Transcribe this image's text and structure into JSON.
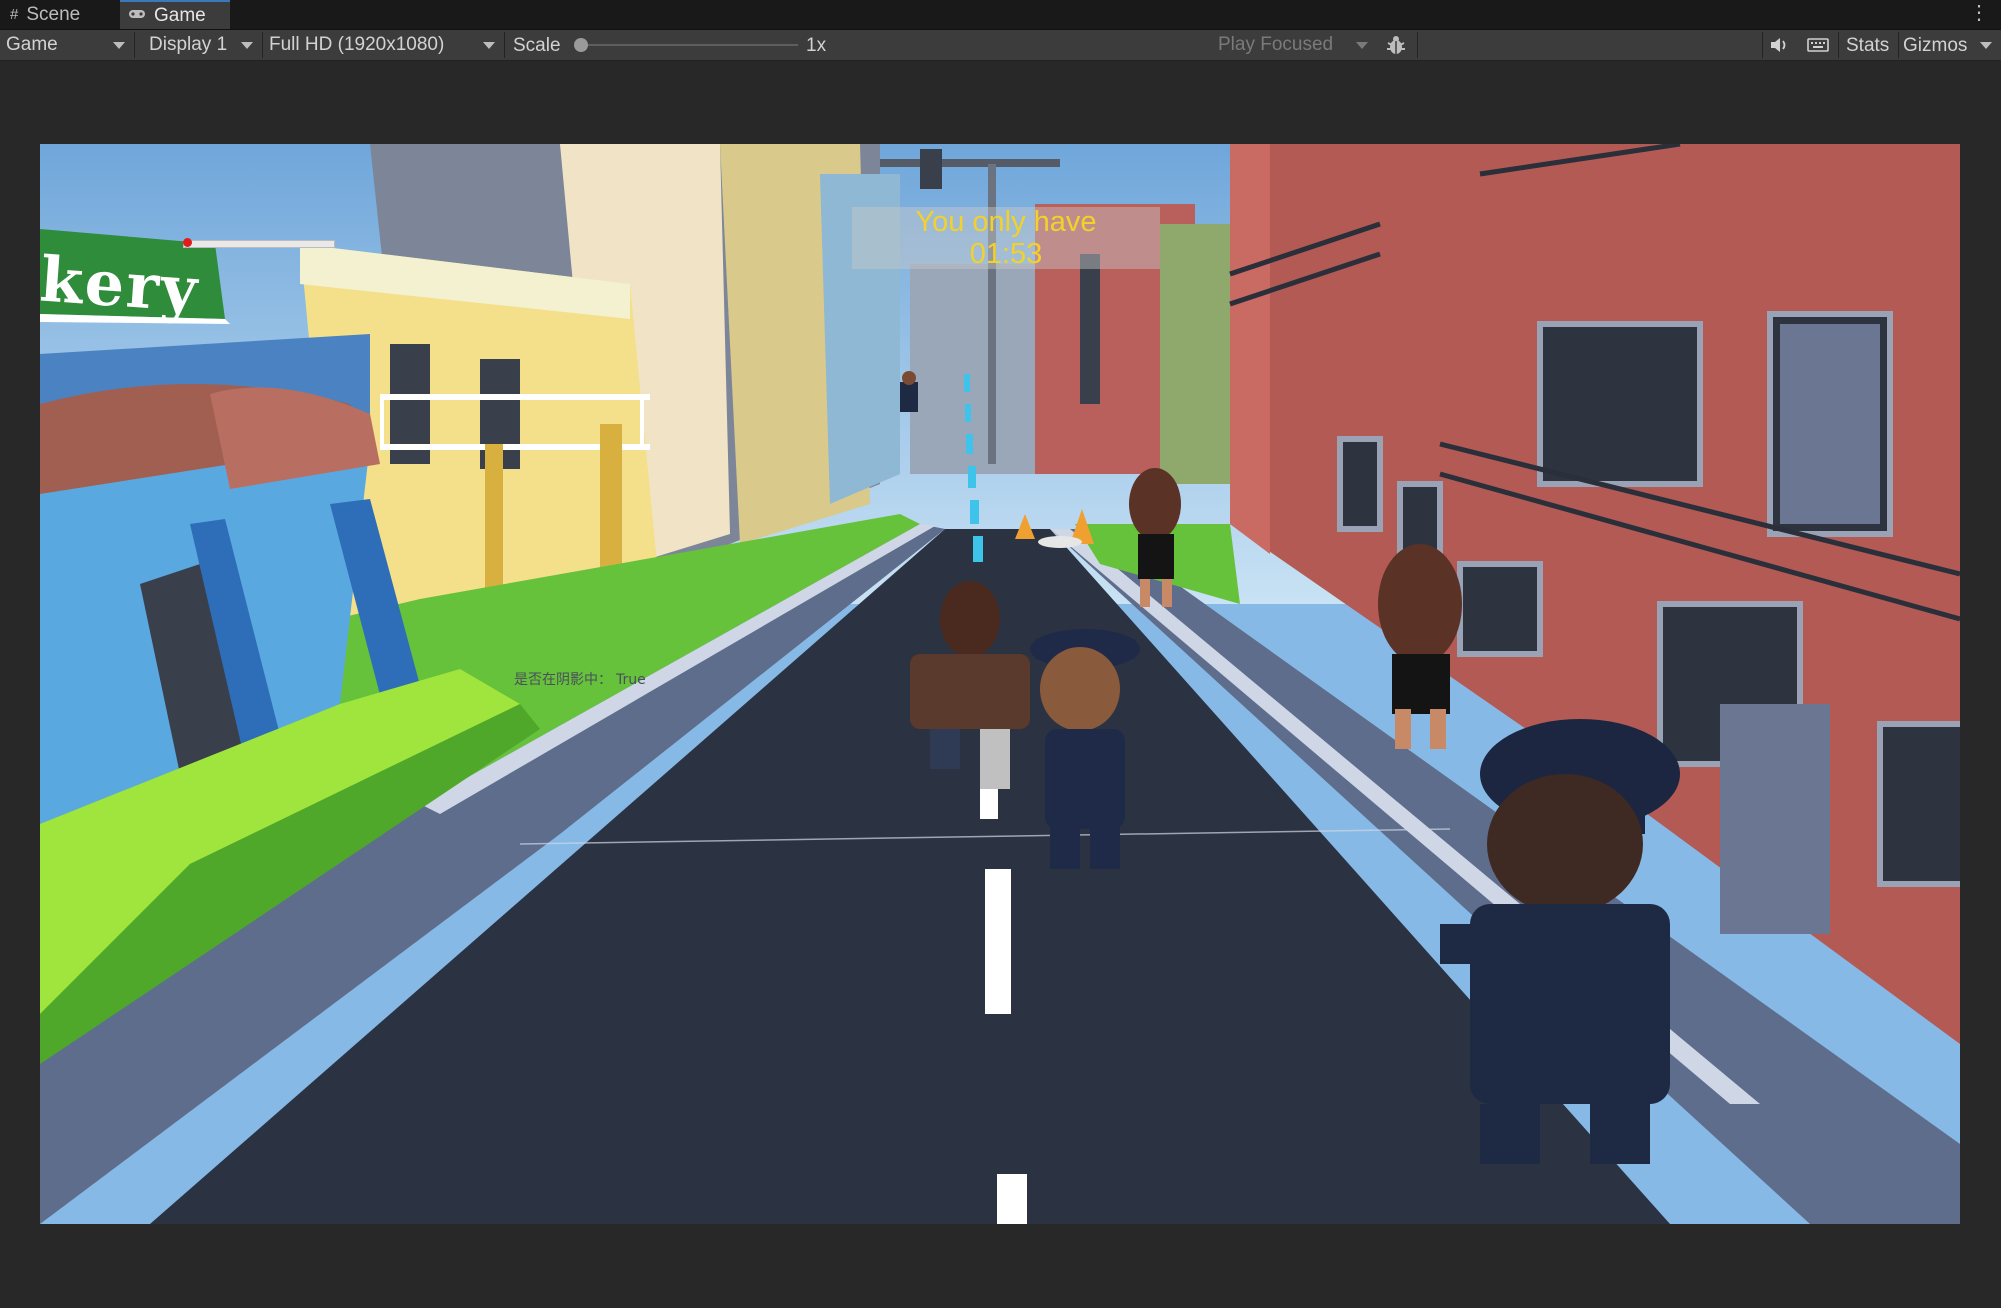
{
  "tabs": [
    {
      "label": "Scene",
      "icon": "grid-icon"
    },
    {
      "label": "Game",
      "icon": "gamepad-icon",
      "active": true
    }
  ],
  "toolbar": {
    "view_mode": "Game",
    "display": "Display 1",
    "resolution": "Full HD (1920x1080)",
    "scale_label": "Scale",
    "scale_value": "1x",
    "scale_level": 0,
    "play_mode": "Play Focused",
    "stats_label": "Stats",
    "gizmos_label": "Gizmos"
  },
  "game": {
    "timer_line1": "You only have",
    "timer_line2": "01:53",
    "shadow_debug_label": "是否在阴影中：",
    "shadow_debug_value": "True",
    "shop_sign": "kery",
    "health_level": 0,
    "colors": {
      "timer_text": "#f2d22a",
      "road": "#2b3242",
      "sidewalk": "#5e6d8c",
      "grass": "#66c23a",
      "brick_building": "#b35a55",
      "sky": "#87b9e6"
    }
  }
}
